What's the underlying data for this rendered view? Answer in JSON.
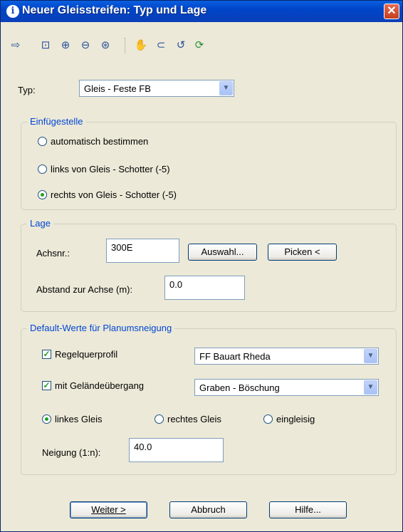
{
  "window": {
    "title": "Neuer Gleisstreifen: Typ und Lage",
    "title_icon": "info-icon",
    "close_label": "✕"
  },
  "toolbar": {
    "icons": [
      "exit-icon",
      "zoom-window-icon",
      "zoom-in-icon",
      "zoom-out-icon",
      "zoom-extents-icon",
      "pan-hand-icon",
      "pick-add-icon",
      "zoom-previous-icon",
      "refresh-icon"
    ]
  },
  "typ": {
    "label": "Typ:",
    "value": "Gleis - Feste FB"
  },
  "einfuegestelle": {
    "title": "Einfügestelle",
    "options": [
      {
        "label": "automatisch bestimmen",
        "selected": false
      },
      {
        "label": "links von Gleis - Schotter (-5)",
        "selected": false
      },
      {
        "label": "rechts von Gleis - Schotter (-5)",
        "selected": true
      }
    ]
  },
  "lage": {
    "title": "Lage",
    "achsnr_label": "Achsnr.:",
    "achsnr_value": "300E",
    "auswahl_button": "Auswahl...",
    "picken_button": "Picken <",
    "abstand_label": "Abstand zur Achse (m):",
    "abstand_value": "0.0"
  },
  "default_werte": {
    "title": "Default-Werte für Planumsneigung",
    "regelquerprofil_label": "Regelquerprofil",
    "regelquerprofil_checked": true,
    "regelquerprofil_value": "FF Bauart Rheda",
    "gelaende_label": "mit Geländeübergang",
    "gelaende_checked": true,
    "gelaende_value": "Graben - Böschung",
    "gleis_options": [
      {
        "label": "linkes Gleis",
        "selected": true
      },
      {
        "label": "rechtes Gleis",
        "selected": false
      },
      {
        "label": "eingleisig",
        "selected": false
      }
    ],
    "neigung_label": "Neigung (1:n):",
    "neigung_value": "40.0"
  },
  "buttons": {
    "weiter": "Weiter >",
    "abbruch": "Abbruch",
    "hilfe": "Hilfe..."
  },
  "colors": {
    "accent": "#0046D5",
    "dialog_bg": "#ECE9D8",
    "titlebar": "#0A5FE0"
  }
}
